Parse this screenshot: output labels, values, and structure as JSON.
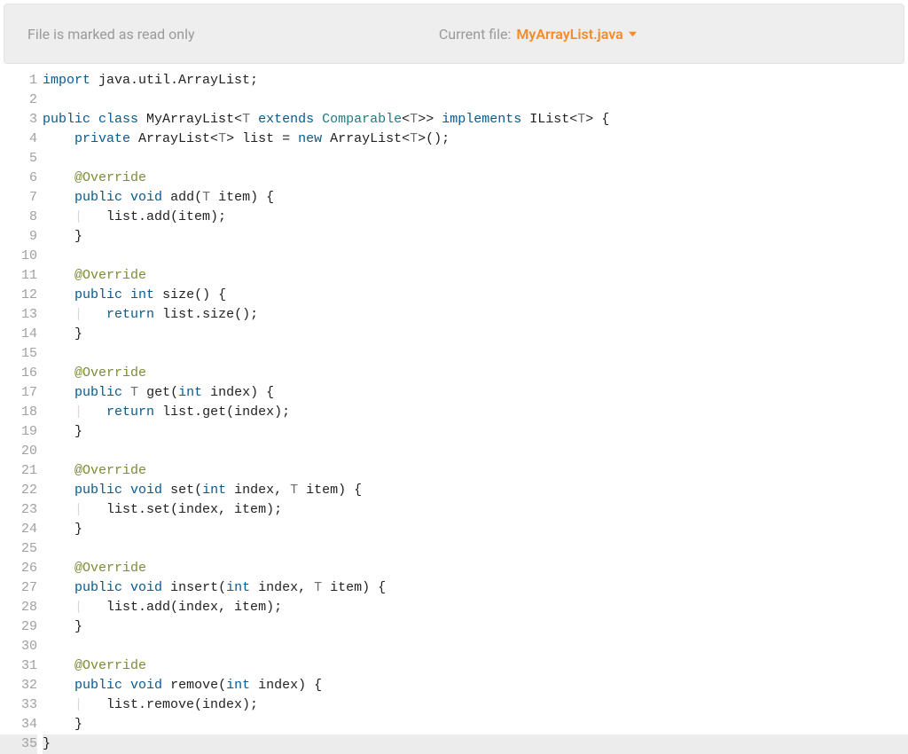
{
  "header": {
    "readonly_text": "File is marked as read only",
    "current_file_label": "Current file:",
    "filename": "MyArrayList.java"
  },
  "editor": {
    "highlighted_line": 35,
    "lines": [
      {
        "n": 1,
        "tokens": [
          {
            "c": "kw",
            "t": "import"
          },
          {
            "t": " java.util.ArrayList;"
          }
        ]
      },
      {
        "n": 2,
        "tokens": []
      },
      {
        "n": 3,
        "tokens": [
          {
            "c": "kw",
            "t": "public"
          },
          {
            "t": " "
          },
          {
            "c": "kw",
            "t": "class"
          },
          {
            "t": " MyArrayList<"
          },
          {
            "c": "ty",
            "t": "T"
          },
          {
            "t": " "
          },
          {
            "c": "kw",
            "t": "extends"
          },
          {
            "t": " "
          },
          {
            "c": "cls",
            "t": "Comparable"
          },
          {
            "t": "<"
          },
          {
            "c": "ty",
            "t": "T"
          },
          {
            "t": ">> "
          },
          {
            "c": "kw",
            "t": "implements"
          },
          {
            "t": " IList<"
          },
          {
            "c": "ty",
            "t": "T"
          },
          {
            "t": "> {"
          }
        ]
      },
      {
        "n": 4,
        "tokens": [
          {
            "t": "    "
          },
          {
            "c": "kw",
            "t": "private"
          },
          {
            "t": " ArrayList<"
          },
          {
            "c": "ty",
            "t": "T"
          },
          {
            "t": "> list = "
          },
          {
            "c": "kw",
            "t": "new"
          },
          {
            "t": " ArrayList<"
          },
          {
            "c": "ty",
            "t": "T"
          },
          {
            "t": ">();"
          }
        ]
      },
      {
        "n": 5,
        "tokens": []
      },
      {
        "n": 6,
        "tokens": [
          {
            "t": "    "
          },
          {
            "c": "ann",
            "t": "@Override"
          }
        ]
      },
      {
        "n": 7,
        "tokens": [
          {
            "t": "    "
          },
          {
            "c": "kw",
            "t": "public"
          },
          {
            "t": " "
          },
          {
            "c": "kw",
            "t": "void"
          },
          {
            "t": " add("
          },
          {
            "c": "ty",
            "t": "T"
          },
          {
            "t": " item) {"
          }
        ]
      },
      {
        "n": 8,
        "tokens": [
          {
            "t": "    "
          },
          {
            "c": "guide",
            "t": "|"
          },
          {
            "t": "   list.add(item);"
          }
        ]
      },
      {
        "n": 9,
        "tokens": [
          {
            "t": "    }"
          }
        ]
      },
      {
        "n": 10,
        "tokens": []
      },
      {
        "n": 11,
        "tokens": [
          {
            "t": "    "
          },
          {
            "c": "ann",
            "t": "@Override"
          }
        ]
      },
      {
        "n": 12,
        "tokens": [
          {
            "t": "    "
          },
          {
            "c": "kw",
            "t": "public"
          },
          {
            "t": " "
          },
          {
            "c": "kw",
            "t": "int"
          },
          {
            "t": " size() {"
          }
        ]
      },
      {
        "n": 13,
        "tokens": [
          {
            "t": "    "
          },
          {
            "c": "guide",
            "t": "|"
          },
          {
            "t": "   "
          },
          {
            "c": "kw",
            "t": "return"
          },
          {
            "t": " list.size();"
          }
        ]
      },
      {
        "n": 14,
        "tokens": [
          {
            "t": "    }"
          }
        ]
      },
      {
        "n": 15,
        "tokens": []
      },
      {
        "n": 16,
        "tokens": [
          {
            "t": "    "
          },
          {
            "c": "ann",
            "t": "@Override"
          }
        ]
      },
      {
        "n": 17,
        "tokens": [
          {
            "t": "    "
          },
          {
            "c": "kw",
            "t": "public"
          },
          {
            "t": " "
          },
          {
            "c": "ty",
            "t": "T"
          },
          {
            "t": " get("
          },
          {
            "c": "kw",
            "t": "int"
          },
          {
            "t": " index) {"
          }
        ]
      },
      {
        "n": 18,
        "tokens": [
          {
            "t": "    "
          },
          {
            "c": "guide",
            "t": "|"
          },
          {
            "t": "   "
          },
          {
            "c": "kw",
            "t": "return"
          },
          {
            "t": " list.get(index);"
          }
        ]
      },
      {
        "n": 19,
        "tokens": [
          {
            "t": "    }"
          }
        ]
      },
      {
        "n": 20,
        "tokens": []
      },
      {
        "n": 21,
        "tokens": [
          {
            "t": "    "
          },
          {
            "c": "ann",
            "t": "@Override"
          }
        ]
      },
      {
        "n": 22,
        "tokens": [
          {
            "t": "    "
          },
          {
            "c": "kw",
            "t": "public"
          },
          {
            "t": " "
          },
          {
            "c": "kw",
            "t": "void"
          },
          {
            "t": " set("
          },
          {
            "c": "kw",
            "t": "int"
          },
          {
            "t": " index, "
          },
          {
            "c": "ty",
            "t": "T"
          },
          {
            "t": " item) {"
          }
        ]
      },
      {
        "n": 23,
        "tokens": [
          {
            "t": "    "
          },
          {
            "c": "guide",
            "t": "|"
          },
          {
            "t": "   list.set(index, item);"
          }
        ]
      },
      {
        "n": 24,
        "tokens": [
          {
            "t": "    }"
          }
        ]
      },
      {
        "n": 25,
        "tokens": []
      },
      {
        "n": 26,
        "tokens": [
          {
            "t": "    "
          },
          {
            "c": "ann",
            "t": "@Override"
          }
        ]
      },
      {
        "n": 27,
        "tokens": [
          {
            "t": "    "
          },
          {
            "c": "kw",
            "t": "public"
          },
          {
            "t": " "
          },
          {
            "c": "kw",
            "t": "void"
          },
          {
            "t": " insert("
          },
          {
            "c": "kw",
            "t": "int"
          },
          {
            "t": " index, "
          },
          {
            "c": "ty",
            "t": "T"
          },
          {
            "t": " item) {"
          }
        ]
      },
      {
        "n": 28,
        "tokens": [
          {
            "t": "    "
          },
          {
            "c": "guide",
            "t": "|"
          },
          {
            "t": "   list.add(index, item);"
          }
        ]
      },
      {
        "n": 29,
        "tokens": [
          {
            "t": "    }"
          }
        ]
      },
      {
        "n": 30,
        "tokens": []
      },
      {
        "n": 31,
        "tokens": [
          {
            "t": "    "
          },
          {
            "c": "ann",
            "t": "@Override"
          }
        ]
      },
      {
        "n": 32,
        "tokens": [
          {
            "t": "    "
          },
          {
            "c": "kw",
            "t": "public"
          },
          {
            "t": " "
          },
          {
            "c": "kw",
            "t": "void"
          },
          {
            "t": " remove("
          },
          {
            "c": "kw",
            "t": "int"
          },
          {
            "t": " index) {"
          }
        ]
      },
      {
        "n": 33,
        "tokens": [
          {
            "t": "    "
          },
          {
            "c": "guide",
            "t": "|"
          },
          {
            "t": "   list.remove(index);"
          }
        ]
      },
      {
        "n": 34,
        "tokens": [
          {
            "t": "    }"
          }
        ]
      },
      {
        "n": 35,
        "tokens": [
          {
            "t": "}"
          }
        ]
      }
    ]
  }
}
